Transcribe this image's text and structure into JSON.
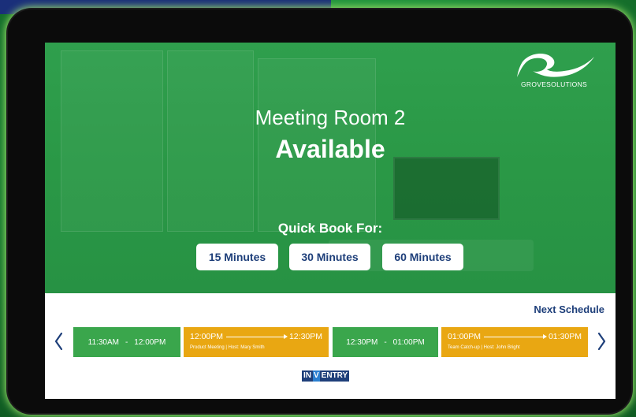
{
  "logo": {
    "text": "GROVESOLUTIONS"
  },
  "room": {
    "name": "Meeting Room 2",
    "status": "Available"
  },
  "quick_book": {
    "label": "Quick Book For:",
    "options": [
      "15 Minutes",
      "30 Minutes",
      "60 Minutes"
    ]
  },
  "schedule": {
    "heading": "Next Schedule",
    "slots": [
      {
        "type": "free",
        "start": "11:30AM",
        "separator": "-",
        "end": "12:00PM"
      },
      {
        "type": "busy",
        "start": "12:00PM",
        "end": "12:30PM",
        "title": "Product Meeting",
        "host": "Host: Mary Smith"
      },
      {
        "type": "free",
        "start": "12:30PM",
        "separator": "-",
        "end": "01:00PM"
      },
      {
        "type": "busy",
        "start": "01:00PM",
        "end": "01:30PM",
        "title": "Team Catch-up",
        "host": "Host: John Bright"
      }
    ]
  },
  "brand": {
    "part1": "IN",
    "part2": "V",
    "part3": "ENTRY"
  },
  "colors": {
    "hero_green": "#2a9846",
    "free_slot": "#3aa64c",
    "busy_slot": "#e9a712",
    "navy": "#1e3f7a"
  },
  "icons": {
    "prev": "chevron-left-icon",
    "next": "chevron-right-icon"
  }
}
